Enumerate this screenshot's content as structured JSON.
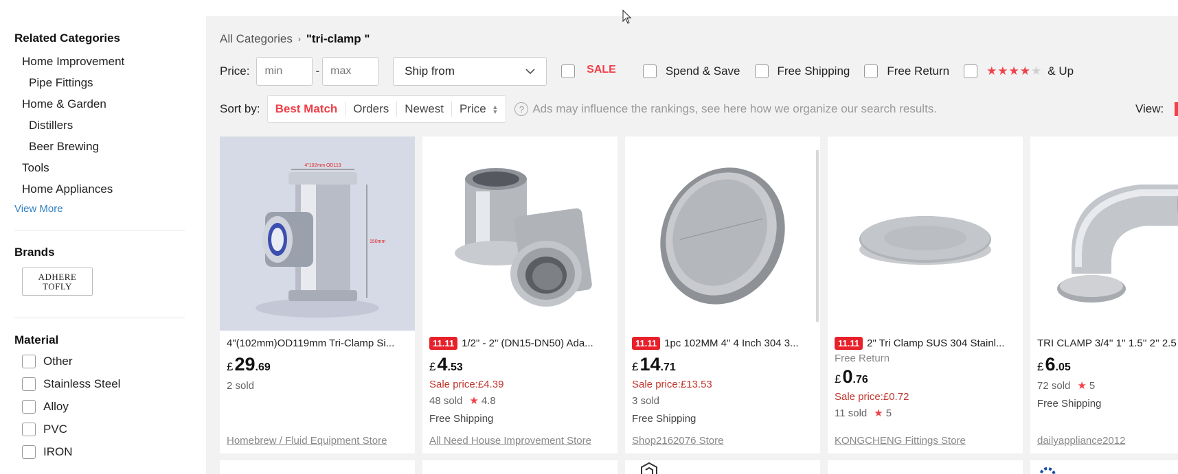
{
  "sidebar": {
    "related_title": "Related Categories",
    "categories": [
      {
        "label": "Home Improvement"
      },
      {
        "label": "Pipe Fittings"
      },
      {
        "label": "Home & Garden"
      },
      {
        "label": "Distillers"
      },
      {
        "label": "Beer Brewing"
      },
      {
        "label": "Tools"
      },
      {
        "label": "Home Appliances"
      }
    ],
    "view_more": "View More",
    "brands_title": "Brands",
    "brand_logo_line1": "ADHERE",
    "brand_logo_line2": "TOFLY",
    "material_title": "Material",
    "materials": [
      {
        "label": "Other"
      },
      {
        "label": "Stainless Steel"
      },
      {
        "label": "Alloy"
      },
      {
        "label": "PVC"
      },
      {
        "label": "IRON"
      }
    ]
  },
  "breadcrumb": {
    "root": "All Categories",
    "separator": "›",
    "query": "\"tri-clamp \""
  },
  "filters": {
    "price_label": "Price:",
    "min_placeholder": "min",
    "max_placeholder": "max",
    "dash": "-",
    "ship_from": "Ship from",
    "sale_label": "SALE",
    "spend_save": "Spend & Save",
    "free_shipping": "Free Shipping",
    "free_return": "Free Return",
    "rating_stars_on": "★★★★",
    "rating_stars_off": "★",
    "rating_up": "& Up"
  },
  "sort": {
    "label": "Sort by:",
    "options": [
      {
        "label": "Best Match"
      },
      {
        "label": "Orders"
      },
      {
        "label": "Newest"
      },
      {
        "label": "Price"
      }
    ],
    "ads_note": "Ads may influence the rankings, see here how we organize our search results.",
    "view_label": "View:"
  },
  "products": [
    {
      "badge": "",
      "title": "4\"(102mm)OD119mm Tri-Clamp Si...",
      "free_return": "",
      "currency": "£",
      "price_int": "29",
      "price_dec": ".69",
      "sale_price": "",
      "sold": "2 sold",
      "rating": "",
      "shipping": "",
      "store": "Homebrew / Fluid Equipment Store"
    },
    {
      "badge": "11.11",
      "title": "1/2\" - 2\" (DN15-DN50) Ada...",
      "free_return": "",
      "currency": "£",
      "price_int": "4",
      "price_dec": ".53",
      "sale_price": "Sale price:£4.39",
      "sold": "48 sold",
      "rating": "4.8",
      "shipping": "Free Shipping",
      "store": "All Need House Improvement Store"
    },
    {
      "badge": "11.11",
      "title": "1pc 102MM 4\" 4 Inch 304 3...",
      "free_return": "",
      "currency": "£",
      "price_int": "14",
      "price_dec": ".71",
      "sale_price": "Sale price:£13.53",
      "sold": "3 sold",
      "rating": "",
      "shipping": "Free Shipping",
      "store": "Shop2162076 Store"
    },
    {
      "badge": "11.11",
      "title": "2\" Tri Clamp SUS 304 Stainl...",
      "free_return": "Free Return",
      "currency": "£",
      "price_int": "0",
      "price_dec": ".76",
      "sale_price": "Sale price:£0.72",
      "sold": "11 sold",
      "rating": "5",
      "shipping": "",
      "store": "KONGCHENG Fittings Store"
    },
    {
      "badge": "",
      "title": "TRI CLAMP 3/4'' 1'' 1.5'' 2'' 2.5",
      "free_return": "",
      "currency": "£",
      "price_int": "6",
      "price_dec": ".05",
      "sale_price": "",
      "sold": "72 sold",
      "rating": "5",
      "shipping": "Free Shipping",
      "store": "dailyappliance2012"
    }
  ],
  "image_labels": {
    "dim_top": "4\"102mm OD119",
    "dim_side": "150mm"
  },
  "colors": {
    "accent": "#f0404a",
    "sale_text": "#c1362d",
    "link": "#2e7fc2",
    "panel_bg": "#f2f2f2"
  }
}
